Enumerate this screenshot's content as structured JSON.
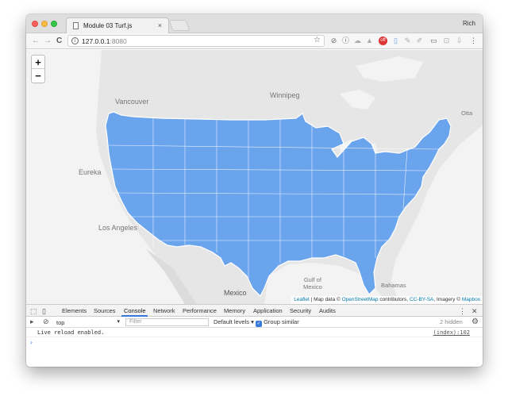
{
  "browser": {
    "tab_title": "Module 03 Turf.js",
    "tab_close": "×",
    "user": "Rich",
    "back_icon": "←",
    "forward_icon": "→",
    "reload_icon": "C",
    "url_host": "127.0.0.1",
    "url_port": ":8080",
    "star_icon": "☆"
  },
  "map": {
    "zoom_in": "+",
    "zoom_out": "−",
    "land_color": "#e6e6e6",
    "water_color": "#f3f3f3",
    "county_fill": "#6aa4ed",
    "county_stroke": "#ffffff",
    "labels": {
      "vancouver": "Vancouver",
      "winnipeg": "Winnipeg",
      "eureka": "Eureka",
      "los_angeles": "Los Angeles",
      "mexico": "Mexico",
      "gulf": "Gulf of",
      "gulf2": "Mexico",
      "bahamas": "Bahamas",
      "ottawa": "Otta"
    },
    "attribution": {
      "leaflet": "Leaflet",
      "sep1": " | Map data © ",
      "osm": "OpenStreetMap",
      "contrib": " contributors, ",
      "license": "CC-BY-SA",
      "imagery": ", Imagery © ",
      "mapbox": "Mapbox"
    }
  },
  "devtools": {
    "tabs": [
      "Elements",
      "Sources",
      "Console",
      "Network",
      "Performance",
      "Memory",
      "Application",
      "Security",
      "Audits"
    ],
    "active_tab": "Console",
    "more_icon": "⋮",
    "close_icon": "✕",
    "context": "top",
    "filter_placeholder": "Filter",
    "levels": "Default levels ▾",
    "group_similar": "Group similar",
    "hidden_count": "2 hidden",
    "settings_icon": "⚙",
    "log_message": "Live reload enabled.",
    "log_source": "(index):102",
    "prompt": "›"
  }
}
